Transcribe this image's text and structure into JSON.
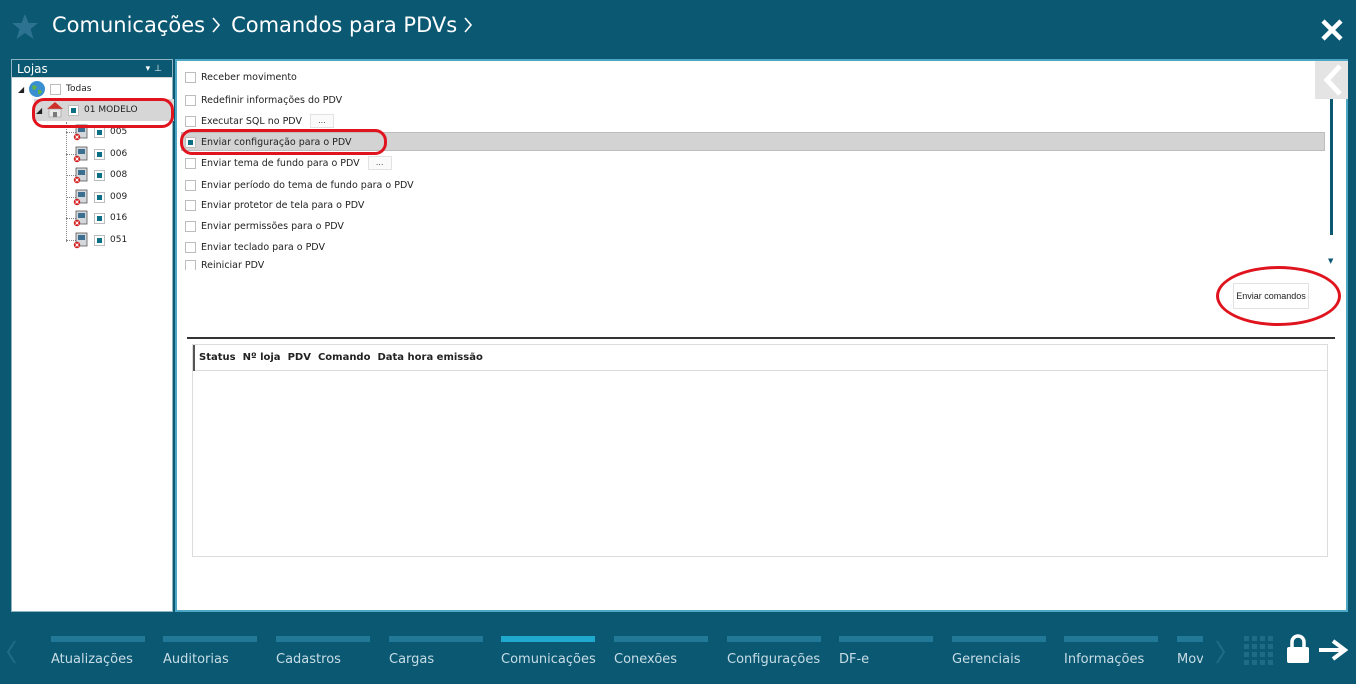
{
  "breadcrumb": [
    "Comunicações",
    "Comandos para PDVs"
  ],
  "tree": {
    "title": "Lojas",
    "root": "Todas",
    "store": "01 MODELO",
    "pdvs": [
      "005",
      "006",
      "008",
      "009",
      "016",
      "051"
    ]
  },
  "commands": [
    "Receber movimento",
    "Redefinir informações do PDV",
    "Executar SQL no PDV",
    "Enviar configuração para o PDV",
    "Enviar tema de fundo para o PDV",
    "Enviar período do tema de fundo para o PDV",
    "Enviar protetor de tela para o PDV",
    "Enviar permissões para o PDV",
    "Enviar teclado para o PDV",
    "Reiniciar PDV"
  ],
  "ellipsis": "...",
  "send_button": "Enviar comandos",
  "grid_columns": [
    "Status",
    "Nº loja",
    "PDV",
    "Comando",
    "Data hora emissão"
  ],
  "nav_tabs": [
    "Atualizações",
    "Auditorias",
    "Cadastros",
    "Cargas",
    "Comunicações",
    "Conexões",
    "Configurações",
    "DF-e",
    "Gerenciais",
    "Informações",
    "Mov"
  ],
  "active_tab": "Comunicações",
  "colors": {
    "primary": "#0b5873",
    "accent": "#1fa9cf",
    "annotation": "#e0141e"
  }
}
